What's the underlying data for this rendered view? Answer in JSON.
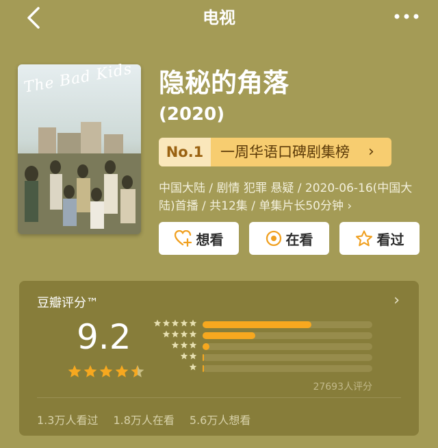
{
  "header": {
    "title": "电视",
    "back_icon": "back-chevron-icon",
    "more_icon": "more-dots-icon"
  },
  "movie": {
    "title": "隐秘的角落",
    "year": "(2020)",
    "poster_art_text": "The Bad Kids",
    "poster_cn_text": "隐秘的角落",
    "rank_no": "No.1",
    "rank_label": "一周华语口碑剧集榜",
    "meta": "中国大陆 / 剧情 犯罪 悬疑 / 2020-06-16(中国大陆)首播 / 共12集 / 单集片长50分钟 ›"
  },
  "actions": [
    {
      "label": "想看",
      "icon": "heart-plus-icon"
    },
    {
      "label": "在看",
      "icon": "circle-dot-icon"
    },
    {
      "label": "看过",
      "icon": "star-outline-icon"
    }
  ],
  "rating": {
    "label": "豆瓣评分™",
    "score": "9.2",
    "stars_value": 4.5,
    "distribution_fraction": [
      0.64,
      0.31,
      0.04,
      0.008,
      0.003
    ],
    "count_text": "27693人评分",
    "stats": [
      "1.3万人看过",
      "1.8万人在看",
      "5.6万人想看"
    ]
  },
  "colors": {
    "background": "#a49b56",
    "card": "#877d3a",
    "accent_orange": "#f7a81f",
    "rank_badge": "#f7cd70"
  }
}
